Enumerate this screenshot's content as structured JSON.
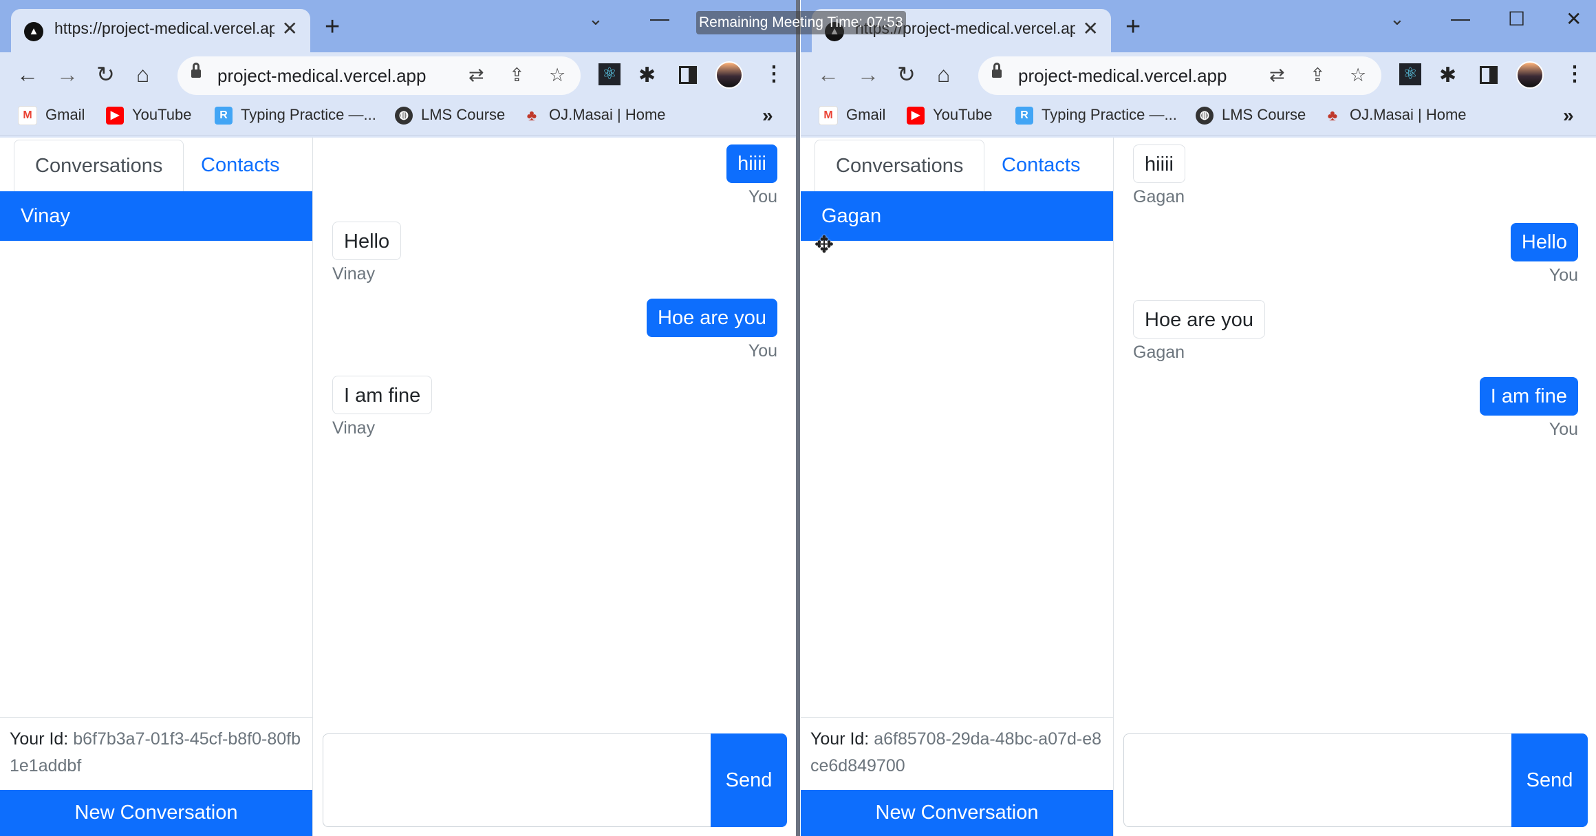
{
  "meeting_banner": "Remaining Meeting Time: 07:53",
  "windows": [
    {
      "tab_title": "https://project-medical.vercel.app",
      "url": "project-medical.vercel.app",
      "bookmarks": [
        "Gmail",
        "YouTube",
        "Typing Practice —...",
        "LMS Course",
        "OJ.Masai | Home"
      ],
      "nav_tabs": [
        "Conversations",
        "Contacts"
      ],
      "selected_conversation": "Vinay",
      "your_id_label": "Your Id:",
      "your_id": "b6f7b3a7-01f3-45cf-b8f0-80fb1e1addbf",
      "new_conversation_label": "New Conversation",
      "send_label": "Send",
      "messages": [
        {
          "text": "hiiii",
          "sender": "You",
          "outgoing": true
        },
        {
          "text": "Hello",
          "sender": "Vinay",
          "outgoing": false
        },
        {
          "text": "Hoe are you",
          "sender": "You",
          "outgoing": true
        },
        {
          "text": "I am fine",
          "sender": "Vinay",
          "outgoing": false
        }
      ]
    },
    {
      "tab_title": "https://project-medical.vercel.app",
      "url": "project-medical.vercel.app",
      "bookmarks": [
        "Gmail",
        "YouTube",
        "Typing Practice —...",
        "LMS Course",
        "OJ.Masai | Home"
      ],
      "nav_tabs": [
        "Conversations",
        "Contacts"
      ],
      "selected_conversation": "Gagan",
      "your_id_label": "Your Id:",
      "your_id": "a6f85708-29da-48bc-a07d-e8ce6d849700",
      "new_conversation_label": "New Conversation",
      "send_label": "Send",
      "messages": [
        {
          "text": "hiiii",
          "sender": "Gagan",
          "outgoing": false
        },
        {
          "text": "Hello",
          "sender": "You",
          "outgoing": true
        },
        {
          "text": "Hoe are you",
          "sender": "Gagan",
          "outgoing": false
        },
        {
          "text": "I am fine",
          "sender": "You",
          "outgoing": true
        }
      ]
    }
  ],
  "colors": {
    "primary": "#0d6efd",
    "tabstrip": "#8fb0ea",
    "toolbar": "#dbe5f7"
  }
}
